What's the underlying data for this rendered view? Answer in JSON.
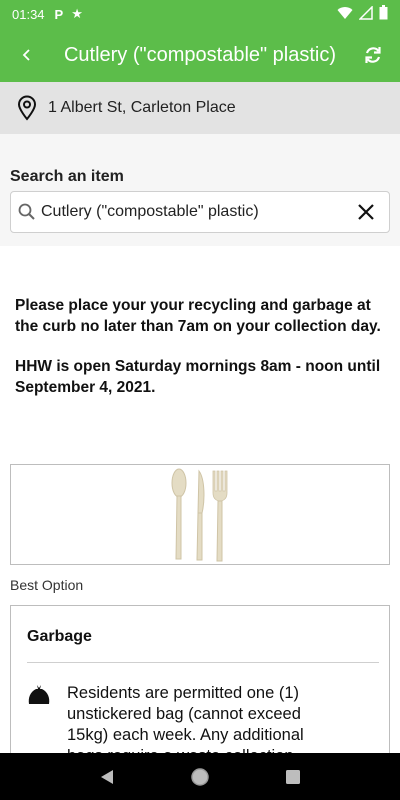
{
  "status_bar": {
    "time": "01:34",
    "icons": [
      "parking-icon",
      "star-icon",
      "wifi-icon",
      "signal-icon",
      "battery-icon"
    ]
  },
  "app_bar": {
    "title": "Cutlery (\"compostable\" plastic)",
    "back_icon": "back-chevron-icon",
    "refresh_icon": "refresh-icon",
    "color": "#5cbd4a"
  },
  "address": {
    "text": "1 Albert St, Carleton Place",
    "icon": "location-pin-icon"
  },
  "search": {
    "label": "Search an item",
    "value": "Cutlery (\"compostable\" plastic)",
    "search_icon": "search-icon",
    "clear_icon": "clear-icon"
  },
  "notice": {
    "paragraph_1": "Please place your your recycling and garbage at the curb no later than 7am on your collection day.",
    "paragraph_2": "HHW is open Saturday mornings 8am - noon until September 4, 2021."
  },
  "item_image": "cutlery-image",
  "best_option_label": "Best Option",
  "result_card": {
    "title": "Garbage",
    "icon": "garbage-bag-icon",
    "description": "Residents are permitted one (1) unstickered bag (cannot exceed 15kg) each week.  Any additional bags require a waste collection"
  },
  "nav_bar": {
    "back_icon": "nav-back-icon",
    "home_icon": "nav-home-icon",
    "recents_icon": "nav-recents-icon"
  }
}
